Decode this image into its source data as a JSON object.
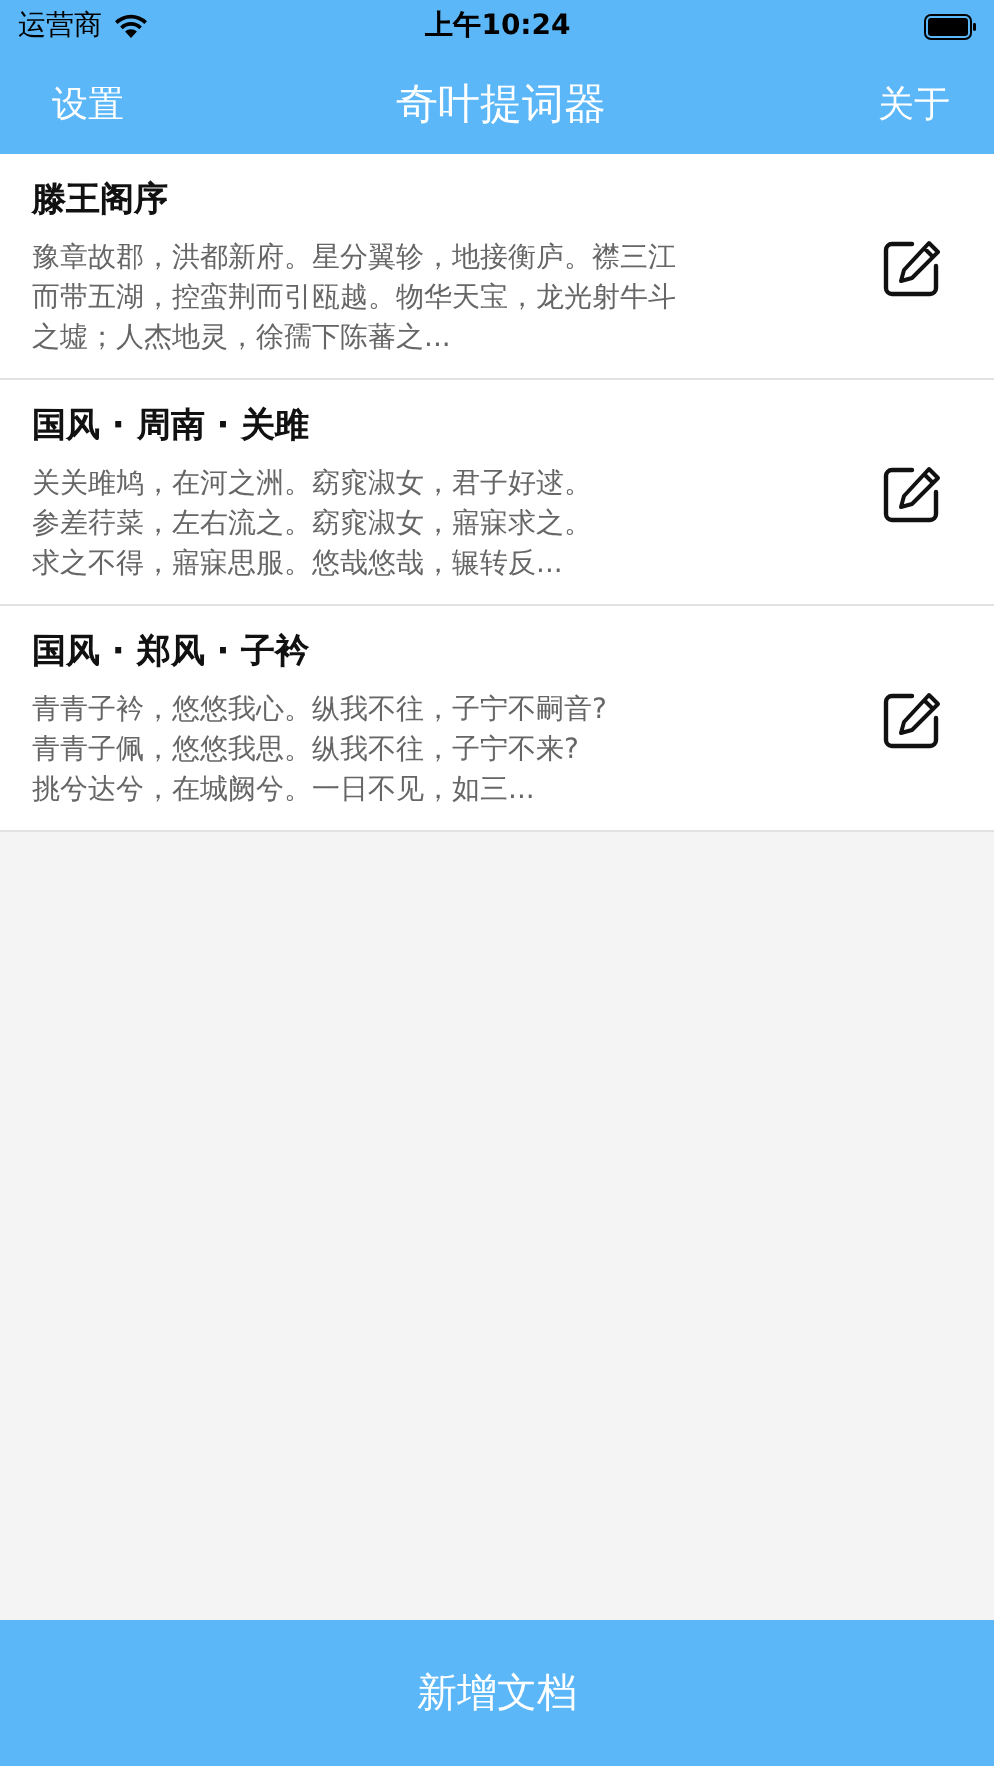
{
  "status_bar": {
    "carrier": "运营商",
    "time": "上午10:24"
  },
  "nav_bar": {
    "left": "设置",
    "title": "奇叶提词器",
    "right": "关于"
  },
  "documents": [
    {
      "title": "滕王阁序",
      "preview_lines": [
        "豫章故郡，洪都新府。星分翼轸，地接衡庐。襟三江",
        "而带五湖，控蛮荆而引瓯越。物华天宝，龙光射牛斗",
        "之墟；人杰地灵，徐孺下陈蕃之..."
      ]
    },
    {
      "title": "国风 · 周南 · 关雎",
      "preview_lines": [
        "关关雎鸠，在河之洲。窈窕淑女，君子好逑。",
        "参差荇菜，左右流之。窈窕淑女，寤寐求之。",
        "求之不得，寤寐思服。悠哉悠哉，辗转反..."
      ]
    },
    {
      "title": "国风 · 郑风 · 子衿",
      "preview_lines": [
        "青青子衿，悠悠我心。纵我不往，子宁不嗣音?",
        "青青子佩，悠悠我思。纵我不往，子宁不来?",
        "挑兮达兮，在城阙兮。一日不见，如三..."
      ]
    }
  ],
  "bottom_button": "新增文档"
}
